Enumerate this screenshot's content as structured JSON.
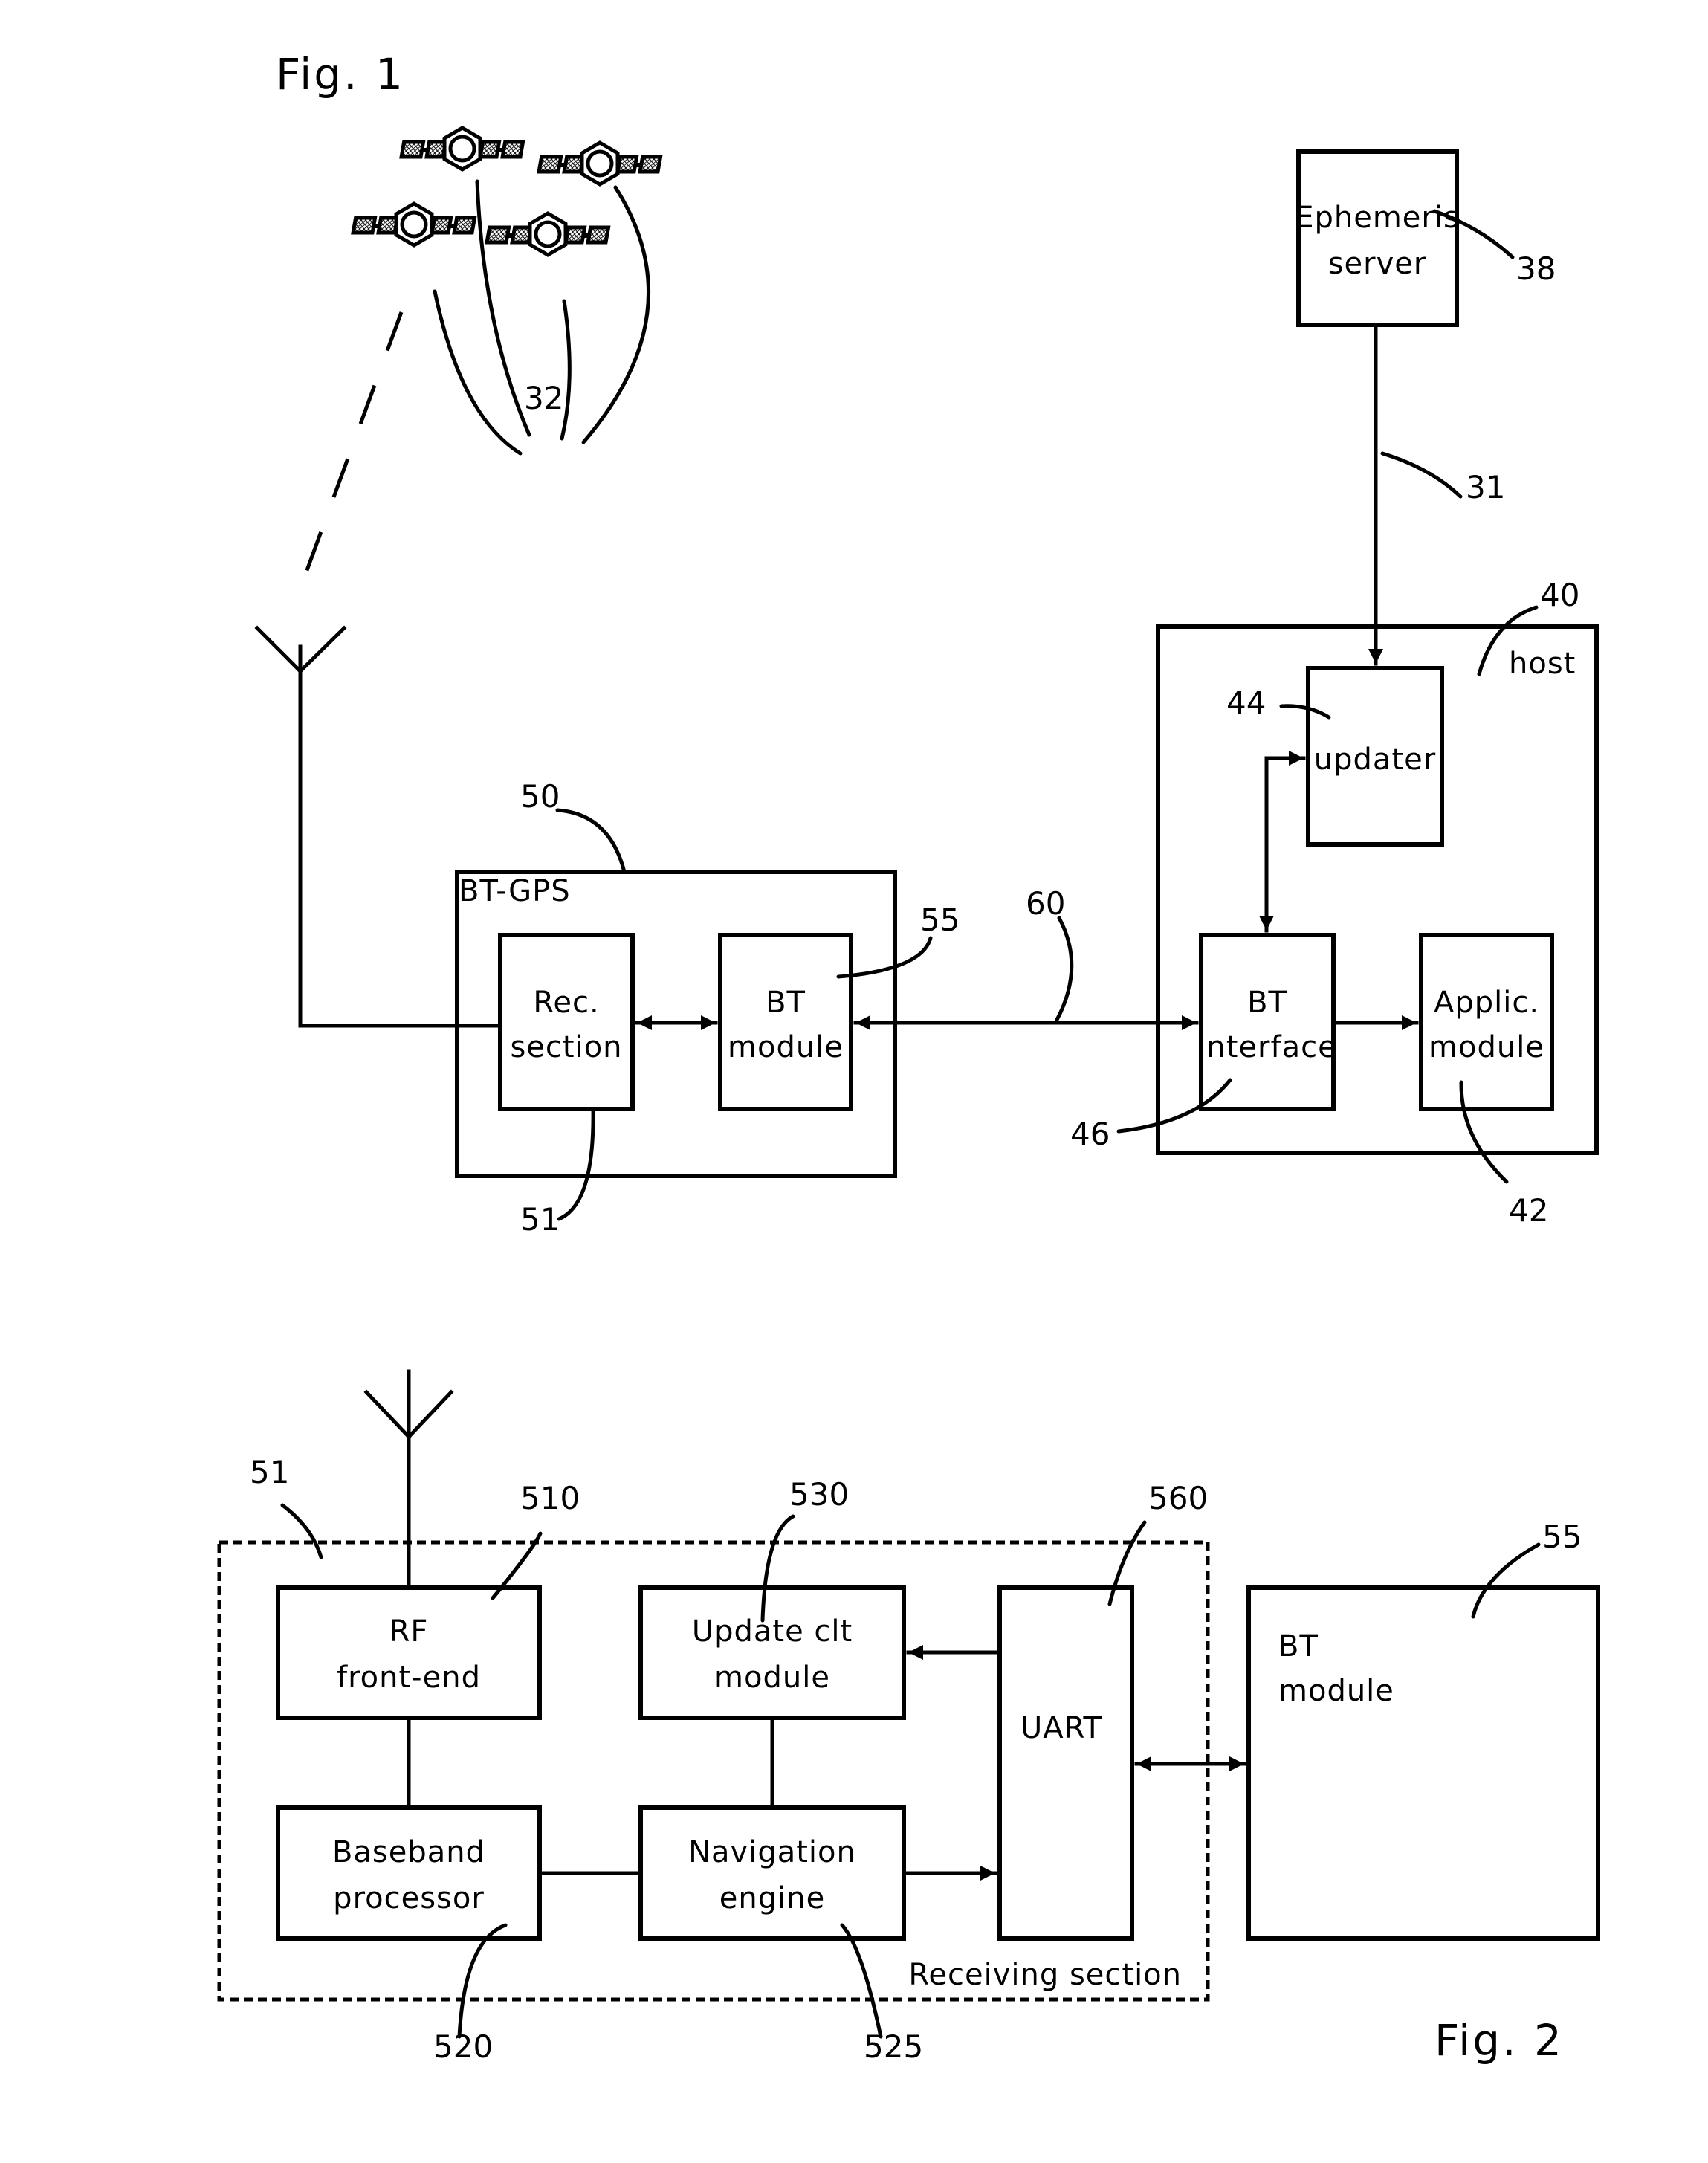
{
  "fig1": {
    "title": "Fig. 1",
    "satellites_ref": "32",
    "ephemeris_server": {
      "line1": "Ephemeris",
      "line2": "server",
      "ref": "38"
    },
    "link_ref": "31",
    "host": {
      "label": "host",
      "ref": "40"
    },
    "updater": {
      "label": "updater",
      "ref": "44"
    },
    "bt_interface": {
      "line1": "BT",
      "line2": "interface",
      "ref": "46"
    },
    "applic_module": {
      "line1": "Applic.",
      "line2": "module",
      "ref": "42"
    },
    "bt_gps": {
      "label": "BT-GPS",
      "ref": "50"
    },
    "rec_section": {
      "line1": "Rec.",
      "line2": "section",
      "ref": "51"
    },
    "bt_module": {
      "line1": "BT",
      "line2": "module",
      "ref": "55"
    },
    "wireless_link_ref": "60"
  },
  "fig2": {
    "title": "Fig. 2",
    "receiving_section": {
      "label": "Receiving section",
      "ref": "51"
    },
    "rf_frontend": {
      "line1": "RF",
      "line2": "front-end",
      "ref": "510"
    },
    "baseband": {
      "line1": "Baseband",
      "line2": "processor",
      "ref": "520"
    },
    "update_clt": {
      "line1": "Update clt",
      "line2": "module",
      "ref": "530"
    },
    "navigation": {
      "line1": "Navigation",
      "line2": "engine",
      "ref": "525"
    },
    "uart": {
      "label": "UART",
      "ref": "560"
    },
    "bt_module": {
      "line1": "BT",
      "line2": "module",
      "ref": "55"
    }
  }
}
